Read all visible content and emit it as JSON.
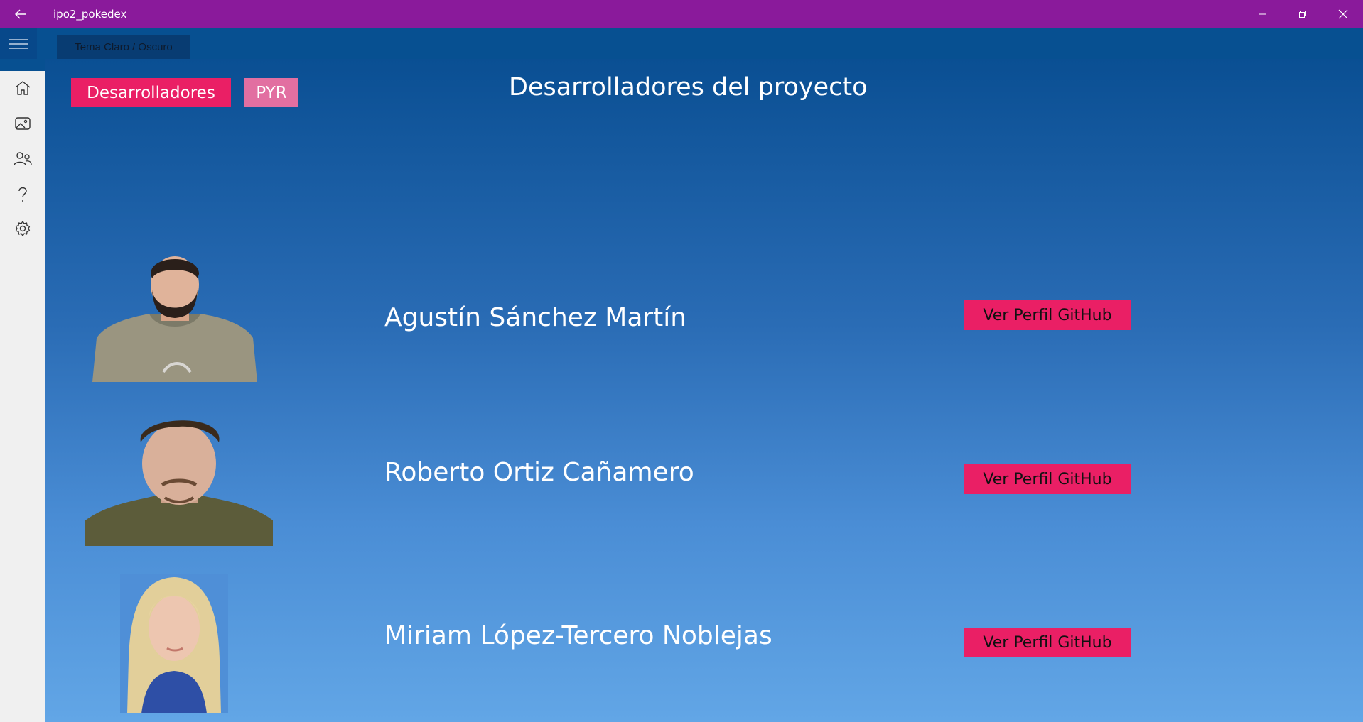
{
  "window": {
    "title": "ipo2_pokedex"
  },
  "toolbar": {
    "theme_toggle_label": "Tema Claro / Oscuro"
  },
  "sidebar": {
    "items": [
      {
        "icon": "home-icon"
      },
      {
        "icon": "gallery-icon"
      },
      {
        "icon": "people-icon"
      },
      {
        "icon": "help-icon"
      },
      {
        "icon": "gear-icon"
      }
    ]
  },
  "tabs": {
    "developers_label": "Desarrolladores",
    "pyr_label": "PYR"
  },
  "page": {
    "title": "Desarrolladores del proyecto"
  },
  "developers": [
    {
      "name": "Agustín Sánchez Martín",
      "button_label": "Ver Perfil GitHub"
    },
    {
      "name": "Roberto Ortiz Cañamero",
      "button_label": "Ver Perfil GitHub"
    },
    {
      "name": "Miriam López-Tercero Noblejas",
      "button_label": "Ver Perfil GitHub"
    }
  ],
  "colors": {
    "titlebar": "#8a1a9b",
    "accent": "#ea1f65",
    "accent_light": "#e26fa1",
    "gradient_top": "#0a4f93",
    "gradient_bottom": "#62a6e6"
  }
}
